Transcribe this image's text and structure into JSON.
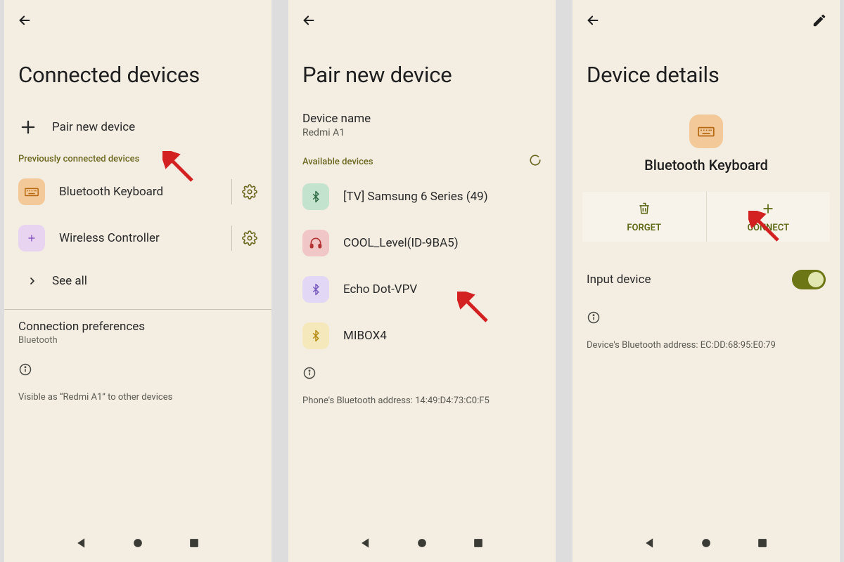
{
  "screen1": {
    "title": "Connected devices",
    "pair_new": "Pair new device",
    "prev_header": "Previously connected devices",
    "devices": [
      {
        "name": "Bluetooth Keyboard",
        "icon": "keyboard",
        "chip": "orange"
      },
      {
        "name": "Wireless Controller",
        "icon": "gamepad",
        "chip": "purple"
      }
    ],
    "see_all": "See all",
    "pref_title": "Connection preferences",
    "pref_sub": "Bluetooth",
    "visible_note": "Visible as “Redmi A1” to other devices"
  },
  "screen2": {
    "title": "Pair new device",
    "device_name_label": "Device name",
    "device_name_value": "Redmi A1",
    "available_header": "Available devices",
    "available": [
      {
        "name": "[TV] Samsung 6 Series (49)",
        "chip": "green"
      },
      {
        "name": "COOL_Level(ID-9BA5)",
        "chip": "red"
      },
      {
        "name": "Echo Dot-VPV",
        "chip": "lav"
      },
      {
        "name": "MIBOX4",
        "chip": "yel"
      }
    ],
    "addr_note": "Phone's Bluetooth address: 14:49:D4:73:C0:F5"
  },
  "screen3": {
    "title": "Device details",
    "device_name": "Bluetooth Keyboard",
    "actions": {
      "forget": "FORGET",
      "connect": "CONNECT"
    },
    "input_device_label": "Input device",
    "input_device_on": true,
    "addr_note": "Device's Bluetooth address: EC:DD:68:95:E0:79"
  },
  "colors": {
    "accent": "#6c6820",
    "action_text": "#5c6814"
  }
}
